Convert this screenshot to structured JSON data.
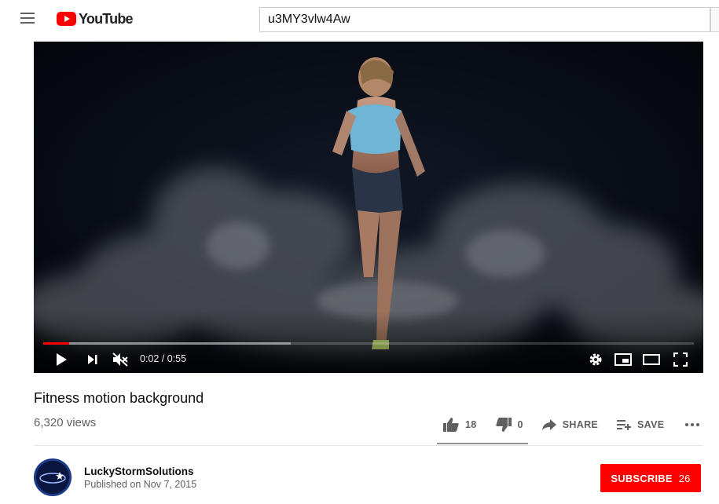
{
  "header": {
    "logo_text": "YouTube",
    "search_value": "u3MY3vlw4Aw"
  },
  "player": {
    "time": "0:02 / 0:55",
    "played_fraction": 0.04,
    "loaded_fraction": 0.38
  },
  "video": {
    "title": "Fitness motion background",
    "views": "6,320 views",
    "likes": "18",
    "dislikes": "0",
    "share_label": "SHARE",
    "save_label": "SAVE"
  },
  "channel": {
    "name": "LuckyStormSolutions",
    "published": "Published on Nov 7, 2015",
    "subscribe_label": "SUBSCRIBE",
    "subscriber_count": "26"
  },
  "colors": {
    "brand": "#ff0000",
    "text_primary": "#0f0f0f",
    "text_secondary": "#606060"
  }
}
